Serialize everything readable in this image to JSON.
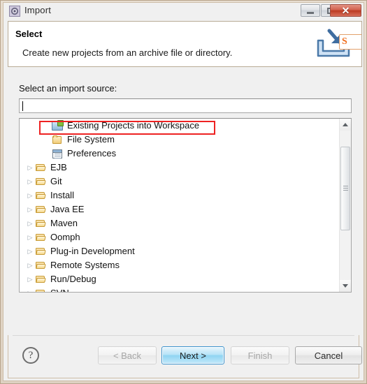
{
  "window": {
    "title": "Import",
    "icon": "eclipse-icon",
    "controls": {
      "minimize": "minimize-button",
      "maximize": "maximize-button",
      "close": "✕"
    }
  },
  "header": {
    "title": "Select",
    "description": "Create new projects from an archive file or directory.",
    "banner_icon": "import-banner-icon",
    "ime_badge": "S"
  },
  "body": {
    "source_label": "Select an import source:",
    "filter": {
      "value": "",
      "placeholder": ""
    },
    "tree": {
      "rows": [
        {
          "label": "Existing Projects into Workspace",
          "level": "child",
          "icon": "project-import-icon",
          "expandable": false,
          "highlighted": true
        },
        {
          "label": "File System",
          "level": "child",
          "icon": "folder-closed-icon",
          "expandable": false,
          "highlighted": false
        },
        {
          "label": "Preferences",
          "level": "child",
          "icon": "preferences-icon",
          "expandable": false,
          "highlighted": false
        },
        {
          "label": "EJB",
          "level": "top",
          "icon": "folder-open-icon",
          "expandable": true,
          "highlighted": false
        },
        {
          "label": "Git",
          "level": "top",
          "icon": "folder-open-icon",
          "expandable": true,
          "highlighted": false
        },
        {
          "label": "Install",
          "level": "top",
          "icon": "folder-open-icon",
          "expandable": true,
          "highlighted": false
        },
        {
          "label": "Java EE",
          "level": "top",
          "icon": "folder-open-icon",
          "expandable": true,
          "highlighted": false
        },
        {
          "label": "Maven",
          "level": "top",
          "icon": "folder-open-icon",
          "expandable": true,
          "highlighted": false
        },
        {
          "label": "Oomph",
          "level": "top",
          "icon": "folder-open-icon",
          "expandable": true,
          "highlighted": false
        },
        {
          "label": "Plug-in Development",
          "level": "top",
          "icon": "folder-open-icon",
          "expandable": true,
          "highlighted": false
        },
        {
          "label": "Remote Systems",
          "level": "top",
          "icon": "folder-open-icon",
          "expandable": true,
          "highlighted": false
        },
        {
          "label": "Run/Debug",
          "level": "top",
          "icon": "folder-open-icon",
          "expandable": true,
          "highlighted": false
        },
        {
          "label": "SVN",
          "level": "top",
          "icon": "folder-open-icon",
          "expandable": true,
          "highlighted": false
        }
      ],
      "scrollbar": {
        "up_arrow": "scroll-up-icon",
        "down_arrow": "scroll-down-icon"
      },
      "annotation_color": "#ee2222"
    }
  },
  "footer": {
    "help": "?",
    "buttons": {
      "back": "< Back",
      "next": "Next >",
      "finish": "Finish",
      "cancel": "Cancel"
    }
  }
}
